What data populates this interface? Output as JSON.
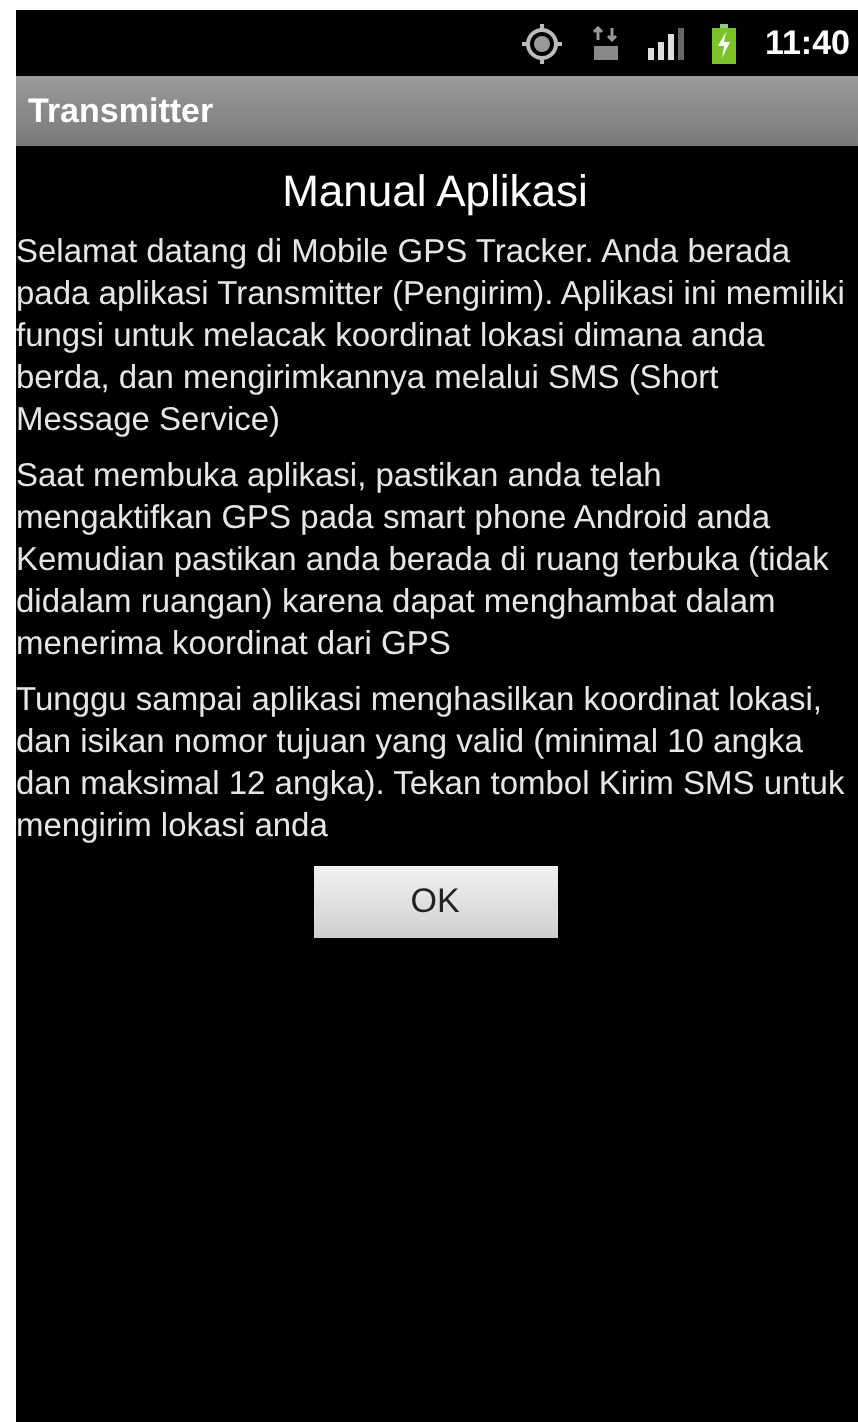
{
  "status_bar": {
    "time": "11:40"
  },
  "title_bar": {
    "title": "Transmitter"
  },
  "dialog": {
    "heading": "Manual Aplikasi",
    "paragraphs": [
      "Selamat datang di Mobile GPS Tracker. Anda berada pada aplikasi Transmitter (Pengirim). Aplikasi ini memiliki fungsi untuk melacak koordinat lokasi dimana anda berda, dan mengirimkannya melalui SMS (Short Message Service)",
      "Saat membuka aplikasi, pastikan anda telah mengaktifkan GPS pada smart phone Android anda Kemudian pastikan anda berada di ruang terbuka (tidak didalam ruangan) karena dapat menghambat dalam menerima koordinat dari GPS",
      "Tunggu sampai aplikasi menghasilkan koordinat lokasi, dan isikan nomor tujuan yang valid (minimal 10 angka dan maksimal 12 angka). Tekan tombol Kirim SMS untuk mengirim lokasi anda"
    ],
    "button": "OK"
  }
}
